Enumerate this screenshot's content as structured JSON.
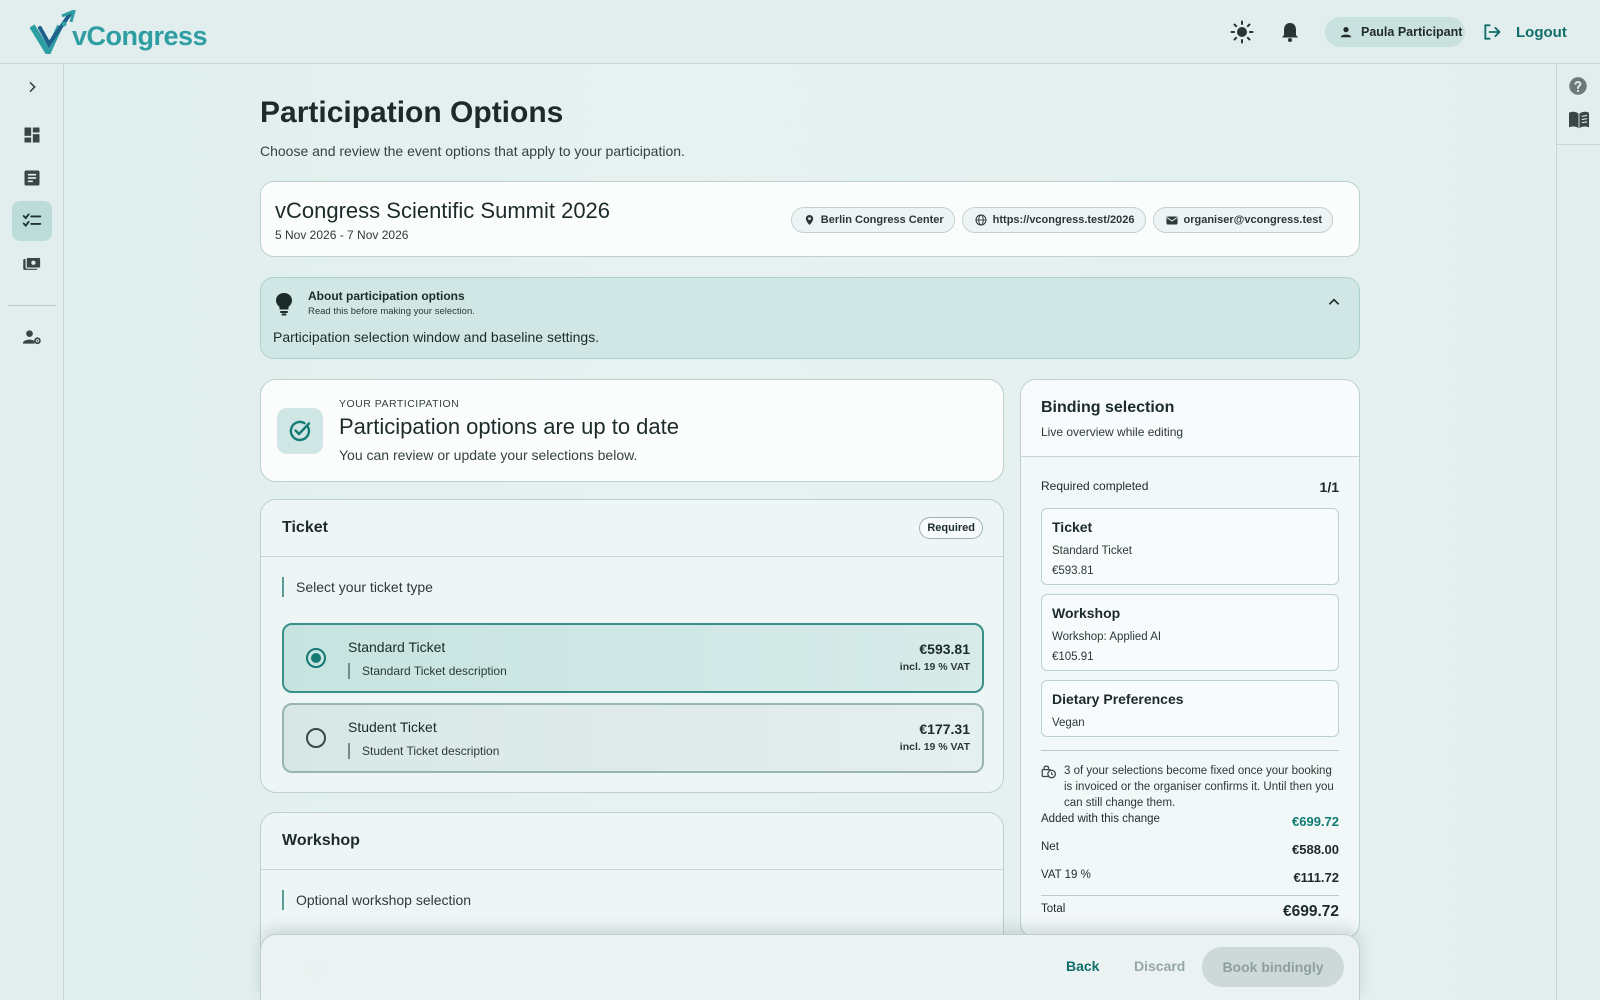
{
  "app": {
    "logo_text": "vCongress",
    "brand_color": "#2f9ea3",
    "accent": "#0f7b72"
  },
  "header": {
    "theme_icon": "sun-icon",
    "notification_icon": "bell-icon",
    "user_name": "Paula Participant",
    "logout_label": "Logout"
  },
  "sidebar": {
    "items": [
      {
        "icon": "chevron-right-icon"
      },
      {
        "icon": "dashboard-icon"
      },
      {
        "icon": "document-icon"
      },
      {
        "icon": "checklist-icon",
        "active": true
      },
      {
        "icon": "payment-icon"
      },
      {
        "icon": "user-settings-icon"
      }
    ]
  },
  "right_rail": {
    "items": [
      {
        "icon": "help-icon"
      },
      {
        "icon": "book-icon"
      }
    ]
  },
  "page": {
    "title": "Participation Options",
    "subtitle": "Choose and review the event options that apply to your participation."
  },
  "event": {
    "name": "vCongress Scientific Summit 2026",
    "dates": "5 Nov 2026 - 7 Nov 2026",
    "location": "Berlin Congress Center",
    "url": "https://vcongress.test/2026",
    "email": "organiser@vcongress.test"
  },
  "info": {
    "title": "About participation options",
    "subtitle": "Read this before making your selection.",
    "body": "Participation selection window and baseline settings."
  },
  "status": {
    "kicker": "YOUR PARTICIPATION",
    "title": "Participation options are up to date",
    "subtitle": "You can review or update your selections below."
  },
  "ticket_section": {
    "title": "Ticket",
    "badge": "Required",
    "hint": "Select your ticket type",
    "options": [
      {
        "name": "Standard Ticket",
        "description": "Standard Ticket description",
        "price": "€593.81",
        "vat": "incl. 19 % VAT",
        "selected": true
      },
      {
        "name": "Student Ticket",
        "description": "Student Ticket description",
        "price": "€177.31",
        "vat": "incl. 19 % VAT",
        "selected": false
      }
    ]
  },
  "workshop_section": {
    "title": "Workshop",
    "hint": "Optional workshop selection"
  },
  "summary": {
    "title": "Binding selection",
    "subtitle": "Live overview while editing",
    "required_label": "Required completed",
    "required_value": "1/1",
    "items": [
      {
        "title": "Ticket",
        "line1": "Standard Ticket",
        "line2": "€593.81"
      },
      {
        "title": "Workshop",
        "line1": "Workshop: Applied AI",
        "line2": "€105.91"
      },
      {
        "title": "Dietary Preferences",
        "line1": "Vegan"
      }
    ],
    "notice": "3 of your selections become fixed once your booking is invoiced or the organiser confirms it. Until then you can still change them.",
    "added_label": "Added with this change",
    "added_value": "€699.72",
    "net_label": "Net",
    "net_value": "€588.00",
    "vat_label": "VAT 19 %",
    "vat_value": "€111.72",
    "total_label": "Total",
    "total_value": "€699.72"
  },
  "actions": {
    "back": "Back",
    "discard": "Discard",
    "book": "Book bindingly"
  }
}
